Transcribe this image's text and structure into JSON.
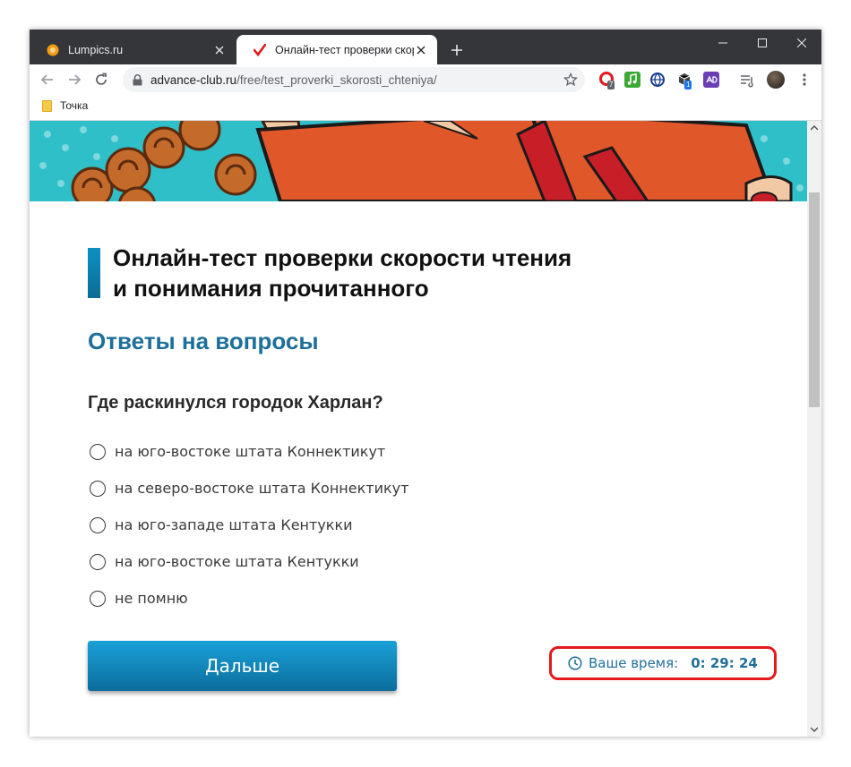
{
  "browser": {
    "tabs": [
      {
        "title": "Lumpics.ru",
        "active": false,
        "favicon": "orange-circle-icon"
      },
      {
        "title": "Онлайн-тест проверки скорости",
        "active": true,
        "favicon": "red-checkmark-icon"
      }
    ],
    "url_domain": "advance-club.ru",
    "url_path": "/free/test_proverki_skorosti_chteniya/",
    "bookmarks": [
      {
        "label": "Точка",
        "icon": "folder-icon"
      }
    ],
    "extension_badges": [
      "7",
      "1"
    ]
  },
  "page": {
    "heading_line1": "Онлайн-тест проверки скорости чтения",
    "heading_line2": "и понимания прочитанного",
    "subheading": "Ответы на вопросы",
    "question": "Где раскинулся городок Харлан?",
    "options": [
      "на юго-востоке штата Коннектикут",
      "на северо-востоке штата Коннектикут",
      "на юго-западе штата Кентукки",
      "на юго-востоке штата Кентукки",
      "не помню"
    ],
    "next_button": "Дальше",
    "timer_label": "Ваше время:",
    "timer_value": "0: 29: 24"
  },
  "colors": {
    "accent_blue": "#1e6f99",
    "button_blue": "#0b6d9c",
    "highlight_red": "#e3191c",
    "tabstrip": "#35363a"
  }
}
